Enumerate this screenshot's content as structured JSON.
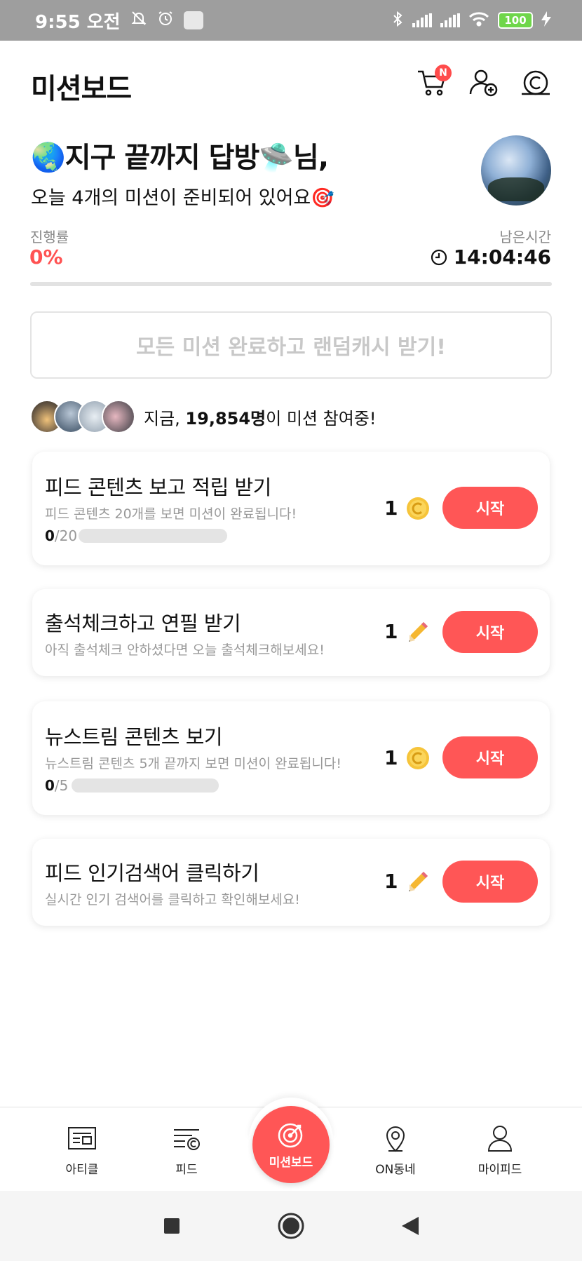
{
  "status_bar": {
    "time": "9:55 오전",
    "battery": "100"
  },
  "header": {
    "title": "미션보드",
    "cart_badge": "N"
  },
  "greeting": {
    "name_line": "🌏지구 끝까지 답방🛸님,",
    "sub_line": "오늘 4개의 미션이 준비되어 있어요🎯"
  },
  "progress": {
    "label": "진행률",
    "value": "0%",
    "fraction": 0
  },
  "remaining": {
    "label": "남은시간",
    "value": "14:04:46"
  },
  "complete_all_label": "모든 미션 완료하고 랜덤캐시 받기!",
  "participants": {
    "prefix": "지금, ",
    "count": "19,854명",
    "suffix": "이 미션 참여중!"
  },
  "missions": [
    {
      "title": "피드 콘텐츠 보고 적립 받기",
      "desc": "피드 콘텐츠 20개를 보면 미션이 완료됩니다!",
      "done": "0",
      "total": "/20",
      "reward": "1",
      "reward_icon": "coin-icon",
      "button": "시작"
    },
    {
      "title": "출석체크하고 연필 받기",
      "desc": "아직 출석체크 안하셨다면 오늘 출석체크해보세요!",
      "reward": "1",
      "reward_icon": "pencil-icon",
      "button": "시작"
    },
    {
      "title": "뉴스트림 콘텐츠 보기",
      "desc": "뉴스트림 콘텐츠 5개 끝까지 보면 미션이 완료됩니다!",
      "done": "0",
      "total": "/5",
      "reward": "1",
      "reward_icon": "coin-icon",
      "button": "시작"
    },
    {
      "title": "피드 인기검색어 클릭하기",
      "desc": "실시간 인기 검색어를 클릭하고 확인해보세요!",
      "reward": "1",
      "reward_icon": "pencil-icon",
      "button": "시작"
    }
  ],
  "bottom_nav": {
    "article": "아티클",
    "feed": "피드",
    "missionboard": "미션보드",
    "on_neighborhood": "ON동네",
    "my_feed": "마이피드"
  },
  "colors": {
    "accent": "#ff5656",
    "progress_text": "#ff5252"
  }
}
